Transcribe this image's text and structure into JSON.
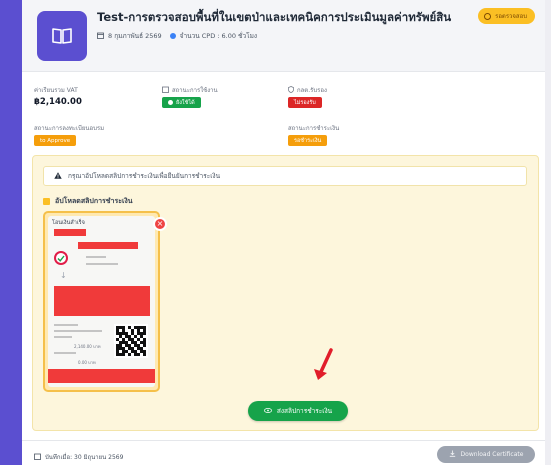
{
  "course": {
    "title": "Test-การตรวจสอบพื้นที่ในเขตป่าและเทคนิคการประเมินมูลค่าทรัพย์สิน",
    "date": "8 กุมภาพันธ์ 2569",
    "cpd": "จำนวน CPD : 6.00 ชั่วโมง",
    "status_chip": "รอตรวจสอบ",
    "icon": "book-icon"
  },
  "info": {
    "fee_label": "ค่าเรียนรวม VAT",
    "fee_value": "฿2,140.00",
    "usage_label": "สถานะการใช้งาน",
    "usage_badge": "ยังใช้ได้",
    "cert_label": "กลต.รับรอง",
    "cert_badge": "ไม่รองรับ",
    "register_label": "สถานะการลงทะเบียนอบรม",
    "register_badge": "to Approve",
    "payment_label": "สถานะการชำระเงิน",
    "payment_badge": "รอชำระเงิน"
  },
  "payment": {
    "notice": "กรุณาอัปโหลดสลิปการชำระเงินเพื่อยืนยันการชำระเงิน",
    "upload_title": "อัปโหลดสลิปการชำระเงิน",
    "slip_heading": "โอนเงินสำเร็จ",
    "slip_amount": "2,140.00 บาท",
    "slip_fee": "0.00 บาท",
    "send_button": "ส่งสลิปการชำระเงิน"
  },
  "footer": {
    "saved_on": "บันทึกเมื่อ: 30 มิถุนายน 2569",
    "download_button": "Download Certificate"
  },
  "colors": {
    "accent": "#5b4fd0",
    "success": "#16a34a",
    "danger": "#dc2626",
    "warning": "#f59e0b",
    "panel_bg": "#fdf6dc"
  }
}
